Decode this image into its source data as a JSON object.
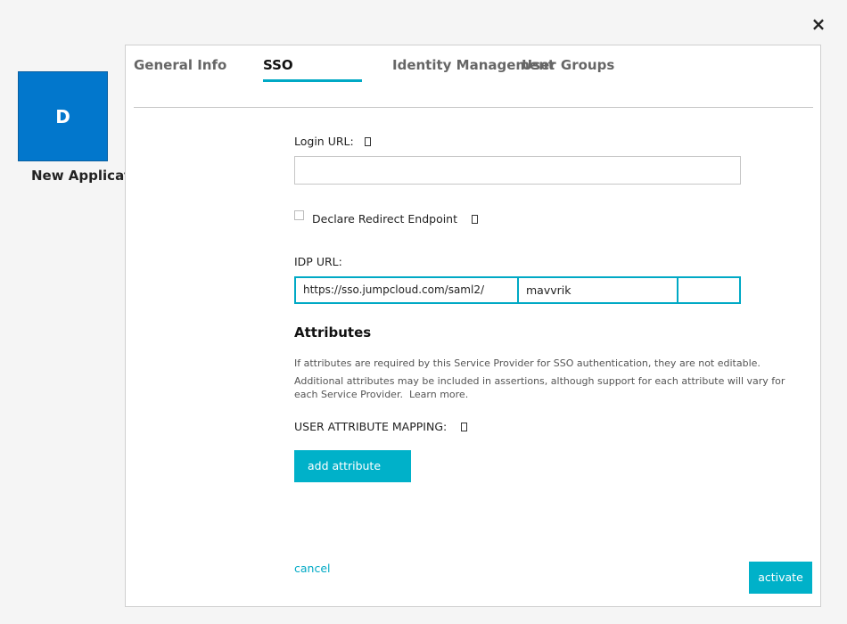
{
  "close_icon": "×",
  "app": {
    "initial": "D",
    "name": "New Application",
    "tile_color": "#0277cc"
  },
  "tabs": [
    {
      "label": "General Info",
      "active": false
    },
    {
      "label": "SSO",
      "active": true
    },
    {
      "label": "Identity Management",
      "active": false
    },
    {
      "label": "User Groups",
      "active": false
    }
  ],
  "accent_color": "#00b1c9",
  "sso": {
    "login_url_label": "Login URL:",
    "login_url_value": "",
    "declare_redirect_label": "Declare Redirect Endpoint",
    "declare_redirect_checked": false,
    "idp_url_label": "IDP URL:",
    "idp_url_prefix": "https://sso.jumpcloud.com/saml2/",
    "idp_url_slug": "mavvrik",
    "idp_url_suffix": "",
    "attributes_heading": "Attributes",
    "attributes_note_1": "If attributes are required by this Service Provider for SSO authentication, they are not editable.",
    "attributes_note_2": "Additional attributes may be included in assertions, although support for each attribute will vary for each Service Provider.",
    "learn_more": "Learn more.",
    "mapping_label": "USER ATTRIBUTE MAPPING:",
    "add_attribute": "add attribute"
  },
  "footer": {
    "cancel": "cancel",
    "activate": "activate"
  }
}
